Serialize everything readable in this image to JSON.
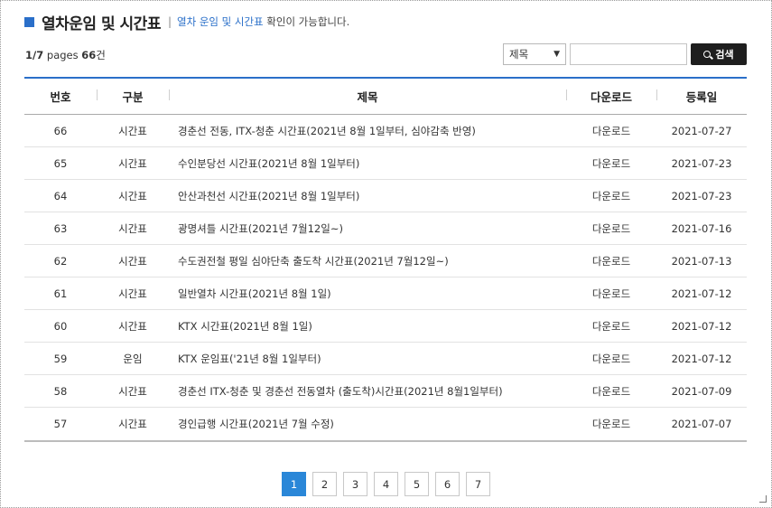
{
  "header": {
    "title": "열차운임 및 시간표",
    "separator": "|",
    "subtitle_highlight": "열차 운임 및 시간표",
    "subtitle_rest": " 확인이 가능합니다."
  },
  "page_info": {
    "current": "1",
    "sep": "/",
    "total": "7",
    "pages_label": " pages ",
    "count": "66",
    "count_unit": "건"
  },
  "search": {
    "field_selected": "제목",
    "input_value": "",
    "button_label": "검색"
  },
  "table": {
    "columns": [
      "번호",
      "구분",
      "제목",
      "다운로드",
      "등록일"
    ],
    "rows": [
      {
        "no": "66",
        "type": "시간표",
        "title": "경춘선 전동, ITX-청춘 시간표(2021년 8월 1일부터, 심야감축 반영)",
        "download": "다운로드",
        "date": "2021-07-27"
      },
      {
        "no": "65",
        "type": "시간표",
        "title": "수인분당선 시간표(2021년 8월 1일부터)",
        "download": "다운로드",
        "date": "2021-07-23"
      },
      {
        "no": "64",
        "type": "시간표",
        "title": "안산과천선 시간표(2021년 8월 1일부터)",
        "download": "다운로드",
        "date": "2021-07-23"
      },
      {
        "no": "63",
        "type": "시간표",
        "title": "광명셔틀 시간표(2021년 7월12일~)",
        "download": "다운로드",
        "date": "2021-07-16"
      },
      {
        "no": "62",
        "type": "시간표",
        "title": "수도권전철 평일 심야단축 출도착 시간표(2021년 7월12일~)",
        "download": "다운로드",
        "date": "2021-07-13"
      },
      {
        "no": "61",
        "type": "시간표",
        "title": "일반열차 시간표(2021년 8월 1일)",
        "download": "다운로드",
        "date": "2021-07-12"
      },
      {
        "no": "60",
        "type": "시간표",
        "title": "KTX 시간표(2021년 8월 1일)",
        "download": "다운로드",
        "date": "2021-07-12"
      },
      {
        "no": "59",
        "type": "운임",
        "title": "KTX 운임표('21년 8월 1일부터)",
        "download": "다운로드",
        "date": "2021-07-12"
      },
      {
        "no": "58",
        "type": "시간표",
        "title": "경춘선 ITX-청춘 및 경춘선 전동열차 (출도착)시간표(2021년 8월1일부터)",
        "download": "다운로드",
        "date": "2021-07-09"
      },
      {
        "no": "57",
        "type": "시간표",
        "title": "경인급행 시간표(2021년 7월 수정)",
        "download": "다운로드",
        "date": "2021-07-07"
      }
    ]
  },
  "pagination": [
    "1",
    "2",
    "3",
    "4",
    "5",
    "6",
    "7"
  ],
  "pagination_active": "1",
  "colors": {
    "accent": "#2a6fc9",
    "active_page": "#2a87d8",
    "search_button": "#1e1e1e"
  }
}
